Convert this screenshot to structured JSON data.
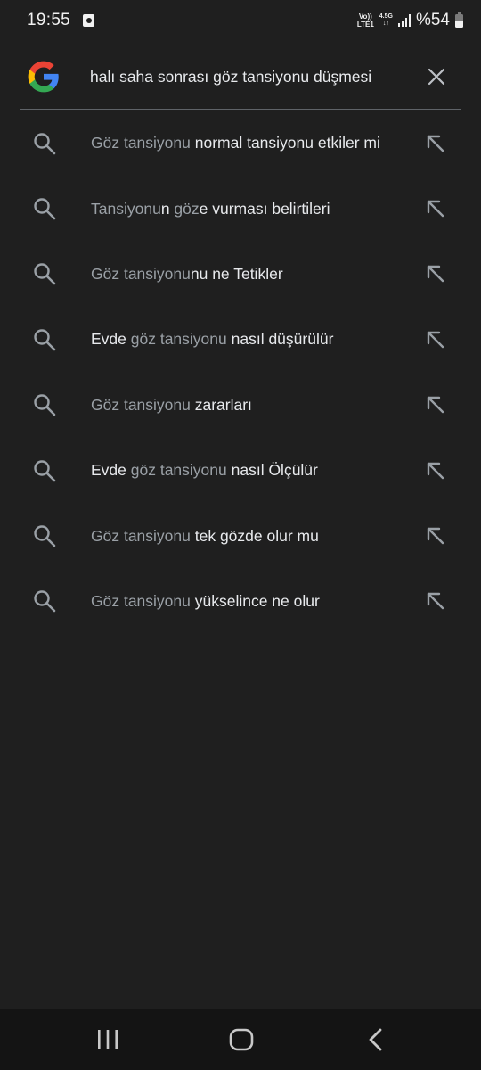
{
  "status_bar": {
    "time": "19:55",
    "volte_top": "Vo))",
    "volte_bottom": "LTE1",
    "network_type": "4.5G",
    "network_arrows": "↓↑",
    "battery_text": "%54",
    "battery_level": 0.54
  },
  "search": {
    "query": "halı saha sonrası göz tansiyonu düşmesi",
    "logo": "google-g-icon",
    "clear_icon": "close-icon"
  },
  "suggestions": [
    {
      "parts": [
        {
          "text": "Göz tansiyonu ",
          "style": "dim"
        },
        {
          "text": "normal tansiyonu etkiler mi",
          "style": "bright"
        }
      ]
    },
    {
      "parts": [
        {
          "text": "Tansiyonu",
          "style": "dim"
        },
        {
          "text": "n ",
          "style": "bright"
        },
        {
          "text": "göz",
          "style": "dim"
        },
        {
          "text": "e vurması belirtileri",
          "style": "bright"
        }
      ]
    },
    {
      "parts": [
        {
          "text": "Göz tansiyonu",
          "style": "dim"
        },
        {
          "text": "nu ne Tetikler",
          "style": "bright"
        }
      ]
    },
    {
      "parts": [
        {
          "text": "Evde ",
          "style": "bright"
        },
        {
          "text": "göz tansiyonu",
          "style": "dim"
        },
        {
          "text": " nasıl düşürülür",
          "style": "bright"
        }
      ]
    },
    {
      "parts": [
        {
          "text": "Göz tansiyonu ",
          "style": "dim"
        },
        {
          "text": "zararları",
          "style": "bright"
        }
      ]
    },
    {
      "parts": [
        {
          "text": "Evde ",
          "style": "bright"
        },
        {
          "text": "göz tansiyonu",
          "style": "dim"
        },
        {
          "text": " nasıl Ölçülür",
          "style": "bright"
        }
      ]
    },
    {
      "parts": [
        {
          "text": "Göz tansiyonu ",
          "style": "dim"
        },
        {
          "text": "tek gözde olur mu",
          "style": "bright"
        }
      ]
    },
    {
      "parts": [
        {
          "text": "Göz tansiyonu ",
          "style": "dim"
        },
        {
          "text": "yükselince ne olur",
          "style": "bright"
        }
      ]
    }
  ],
  "nav_bar": {
    "recents": "recents-icon",
    "home": "home-icon",
    "back": "back-icon"
  },
  "colors": {
    "background": "#1f1f1f",
    "text_bright": "#e8eaed",
    "text_dim": "#9aa0a6",
    "icon": "#9aa0a6",
    "nav_background": "#141414"
  }
}
